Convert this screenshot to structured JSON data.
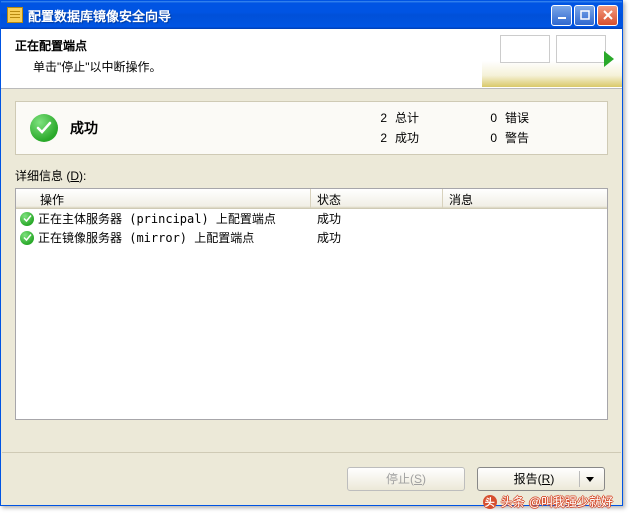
{
  "window": {
    "title": "配置数据库镜像安全向导"
  },
  "header": {
    "title": "正在配置端点",
    "subtitle": "单击\"停止\"以中断操作。"
  },
  "summary": {
    "status_label": "成功",
    "total_count": "2",
    "total_label": "总计",
    "success_count": "2",
    "success_label": "成功",
    "error_count": "0",
    "error_label": "错误",
    "warn_count": "0",
    "warn_label": "警告"
  },
  "details": {
    "label_prefix": "详细信息 (",
    "label_key": "D",
    "label_suffix": "):",
    "columns": {
      "c1": "操作",
      "c2": "状态",
      "c3": "消息"
    },
    "rows": [
      {
        "action": "正在主体服务器 (principal) 上配置端点",
        "status": "成功",
        "message": ""
      },
      {
        "action": "正在镜像服务器 (mirror) 上配置端点",
        "status": "成功",
        "message": ""
      }
    ]
  },
  "footer": {
    "stop_prefix": "停止(",
    "stop_key": "S",
    "stop_suffix": ")",
    "report_prefix": "报告(",
    "report_key": "R",
    "report_suffix": ")"
  },
  "watermark": {
    "source_prefix": "头条",
    "author": "@叫我强少就好"
  }
}
